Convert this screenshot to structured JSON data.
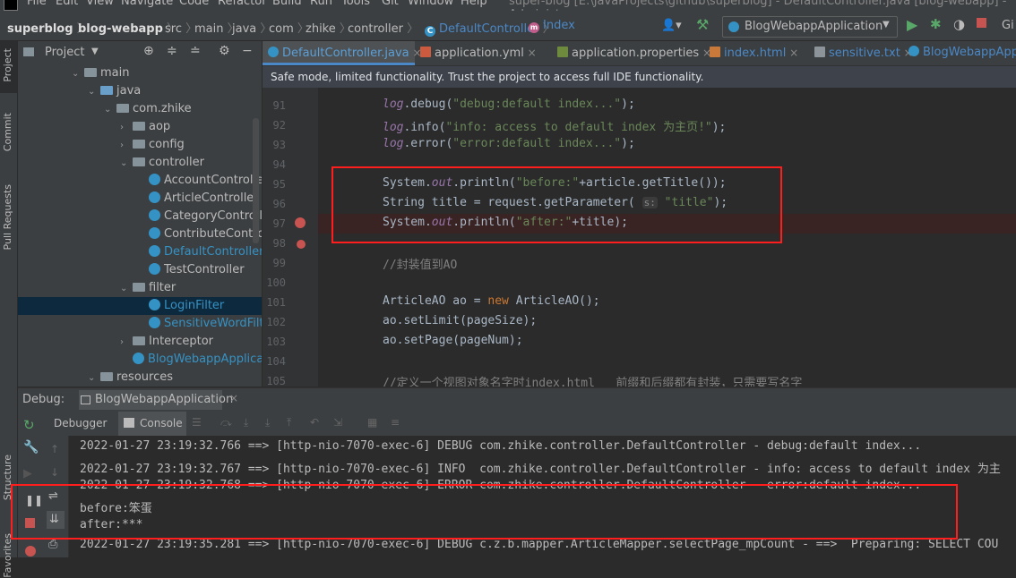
{
  "menu": [
    "File",
    "Edit",
    "View",
    "Navigate",
    "Code",
    "Refactor",
    "Build",
    "Run",
    "Tools",
    "Git",
    "Window",
    "Help"
  ],
  "window_title": "super-blog [E:\\JavaProjects\\github\\superblog] - DefaultController.java [blog-webapp] - Administ",
  "breadcrumb": [
    "superblog",
    "blog-webapp",
    "src",
    "main",
    "java",
    "com",
    "zhike",
    "controller",
    "DefaultController",
    "Index"
  ],
  "run_config": "BlogWebappApplication",
  "project_panel": {
    "title": "Project",
    "tree": [
      {
        "label": "main",
        "indent": 4,
        "type": "folder",
        "open": true
      },
      {
        "label": "java",
        "indent": 5,
        "type": "folder-blue",
        "open": true
      },
      {
        "label": "com.zhike",
        "indent": 6,
        "type": "folder",
        "open": true
      },
      {
        "label": "aop",
        "indent": 7,
        "type": "folder",
        "open": false
      },
      {
        "label": "config",
        "indent": 7,
        "type": "folder",
        "open": false
      },
      {
        "label": "controller",
        "indent": 7,
        "type": "folder",
        "open": true
      },
      {
        "label": "AccountController",
        "indent": 8,
        "type": "class"
      },
      {
        "label": "ArticleController",
        "indent": 8,
        "type": "class"
      },
      {
        "label": "CategoryController",
        "indent": 8,
        "type": "class"
      },
      {
        "label": "ContributeController",
        "indent": 8,
        "type": "class"
      },
      {
        "label": "DefaultController",
        "indent": 8,
        "type": "class",
        "color": "#3592c4"
      },
      {
        "label": "TestController",
        "indent": 8,
        "type": "class"
      },
      {
        "label": "filter",
        "indent": 7,
        "type": "folder",
        "open": true
      },
      {
        "label": "LoginFilter",
        "indent": 8,
        "type": "class",
        "color": "#3592c4",
        "selected": true
      },
      {
        "label": "SensitiveWordFilter",
        "indent": 8,
        "type": "class",
        "color": "#3592c4"
      },
      {
        "label": "Interceptor",
        "indent": 7,
        "type": "folder",
        "open": false
      },
      {
        "label": "BlogWebappApplication",
        "indent": 7,
        "type": "class",
        "color": "#3592c4"
      },
      {
        "label": "resources",
        "indent": 5,
        "type": "folder",
        "open": true
      }
    ]
  },
  "left_strip": [
    "Project",
    "Commit",
    "Pull Requests",
    "Structure",
    "Favorites"
  ],
  "tabs": [
    {
      "label": "DefaultController.java",
      "type": "class",
      "active": true
    },
    {
      "label": "application.yml",
      "type": "yml"
    },
    {
      "label": "application.properties",
      "type": "prop"
    },
    {
      "label": "index.html",
      "type": "html"
    },
    {
      "label": "sensitive.txt",
      "type": "txt"
    },
    {
      "label": "BlogWebappApp",
      "type": "class"
    }
  ],
  "banner": "Safe mode, limited functionality. Trust the project to access full IDE functionality.",
  "code_lines": [
    {
      "n": "91",
      "html": "<span class='lg'>log</span>.debug(<span class='str'>\"debug:default index...\"</span>);"
    },
    {
      "n": "92",
      "html": "<span class='lg'>log</span>.info(<span class='str'>\"info: access to default index 为主页!\"</span>);"
    },
    {
      "n": "93",
      "html": "<span class='lg'>log</span>.error(<span class='str'>\"error:default index...\"</span>);"
    },
    {
      "n": "94",
      "html": ""
    },
    {
      "n": "95",
      "html": "System.<span class='fld'>out</span>.println(<span class='str'>\"before:\"</span>+article.getTitle());"
    },
    {
      "n": "96",
      "html": "String title = request.getParameter( <span class='hint'>s:</span> <span class='str'>\"title\"</span>);"
    },
    {
      "n": "97",
      "html": "System.<span class='fld'>out</span>.println(<span class='str'>\"after:\"</span>+title);"
    },
    {
      "n": "98",
      "html": ""
    },
    {
      "n": "99",
      "html": "<span class='cmt'>//封装值到AO</span>"
    },
    {
      "n": "100",
      "html": ""
    },
    {
      "n": "101",
      "html": "ArticleAO ao = <span class='kw'>new</span> ArticleAO();"
    },
    {
      "n": "102",
      "html": "ao.setLimit(pageSize);"
    },
    {
      "n": "103",
      "html": "ao.setPage(pageNum);"
    },
    {
      "n": "104",
      "html": ""
    },
    {
      "n": "105",
      "html": "<span class='cmt'>//定义一个视图对象名字时index.html   前缀和后缀都有封装，只需要写名字</span>"
    }
  ],
  "debug": {
    "label": "Debug:",
    "config": "BlogWebappApplication",
    "tabs": [
      "Debugger",
      "Console"
    ]
  },
  "console_lines": [
    "2022-01-27 23:19:32.766 ==> [http-nio-7070-exec-6] DEBUG com.zhike.controller.DefaultController - debug:default index...",
    "2022-01-27 23:19:32.767 ==> [http-nio-7070-exec-6] INFO  com.zhike.controller.DefaultController - info: access to default index 为主",
    "2022-01-27 23:19:32.768 ==> [http-nio-7070-exec-6] ERROR com.zhike.controller.DefaultController - error:default index...",
    "before:笨蛋",
    "after:***",
    "2022-01-27 23:19:35.281 ==> [http-nio-7070-exec-6] DEBUG c.z.b.mapper.ArticleMapper.selectPage_mpCount - ==>  Preparing: SELECT COU"
  ]
}
